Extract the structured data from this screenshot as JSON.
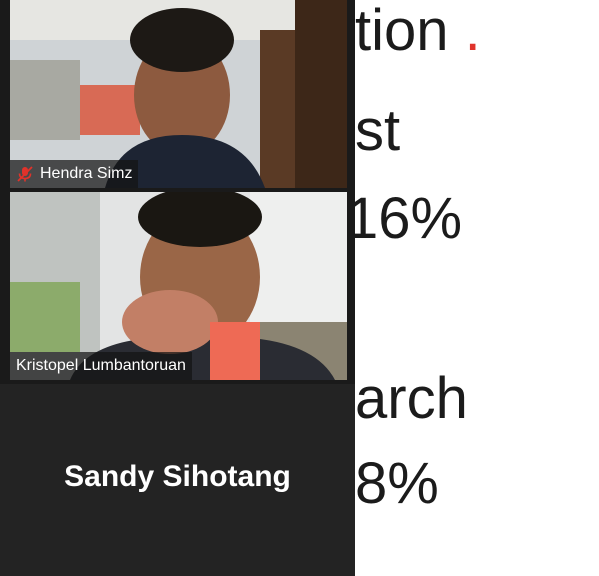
{
  "slide": {
    "lines": [
      "tion.",
      "st",
      "16%",
      "arch",
      "8%"
    ]
  },
  "participants": [
    {
      "name": "Hendra Simz",
      "muted": true
    },
    {
      "name": "Kristopel Lumbantoruan",
      "muted": false
    },
    {
      "name": "Sandy Sihotang",
      "muted": false
    }
  ],
  "colors": {
    "gallery_bg": "#1a1a1a",
    "mute_red": "#e0332b",
    "slide_text": "#1b1b1b"
  }
}
